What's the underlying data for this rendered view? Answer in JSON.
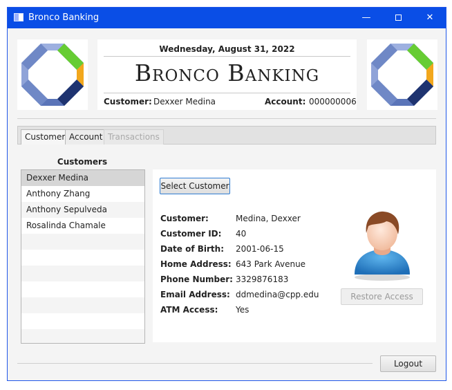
{
  "window": {
    "title": "Bronco Banking",
    "minimize_label": "—",
    "close_label": "✕"
  },
  "header": {
    "date": "Wednesday, August 31, 2022",
    "brand": "Bronco Banking",
    "customer_label": "Customer:",
    "customer_value": "Dexxer Medina",
    "account_label": "Account:",
    "account_value": "000000006"
  },
  "colors": {
    "accent": "#0a4ee6",
    "logo_blue": "#6f88c6",
    "logo_green": "#66cc33",
    "logo_orange": "#f2a71c",
    "logo_navy": "#1e3370"
  },
  "tabs": [
    {
      "label": "Customer",
      "state": "active"
    },
    {
      "label": "Account",
      "state": "normal"
    },
    {
      "label": "Transactions",
      "state": "disabled"
    }
  ],
  "customers": {
    "title": "Customers",
    "items": [
      "Dexxer Medina",
      "Anthony Zhang",
      "Anthony Sepulveda",
      "Rosalinda Chamale"
    ],
    "selected": "Dexxer Medina"
  },
  "details": {
    "select_button": "Select Customer",
    "fields": [
      {
        "label": "Customer:",
        "value": "Medina, Dexxer"
      },
      {
        "label": "Customer ID:",
        "value": "40"
      },
      {
        "label": "Date of Birth:",
        "value": "2001-06-15"
      },
      {
        "label": "Home Address:",
        "value": "643 Park Avenue"
      },
      {
        "label": "Phone Number:",
        "value": "3329876183"
      },
      {
        "label": "Email Address:",
        "value": "ddmedina@cpp.edu"
      },
      {
        "label": "ATM Access:",
        "value": "Yes"
      }
    ],
    "avatar_icon": "user-avatar-icon",
    "restore_button": "Restore Access"
  },
  "footer": {
    "logout_button": "Logout"
  }
}
